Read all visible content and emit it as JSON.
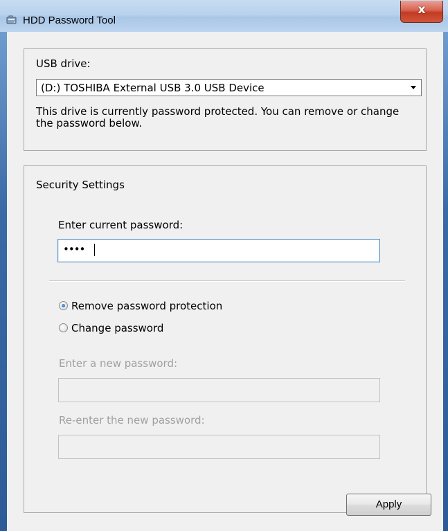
{
  "window": {
    "title": "HDD Password Tool",
    "close_label": "x"
  },
  "usb_group": {
    "label": "USB drive:",
    "selected_drive": "(D:) TOSHIBA External USB 3.0 USB Device",
    "status_text": "This drive is currently password protected. You can remove or change the password below."
  },
  "security_group": {
    "title": "Security Settings",
    "current_password_label": "Enter current password:",
    "current_password_value": "••••",
    "options": [
      {
        "label": "Remove password protection",
        "selected": true
      },
      {
        "label": "Change password",
        "selected": false
      }
    ],
    "new_password_label": "Enter a new password:",
    "reenter_password_label": "Re-enter the new password:"
  },
  "actions": {
    "apply_label": "Apply"
  },
  "colors": {
    "accent": "#1f5fa8",
    "close_red": "#c23b22",
    "disabled_text": "#a0a0a0"
  }
}
